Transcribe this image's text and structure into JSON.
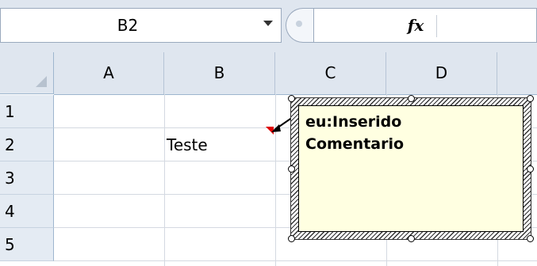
{
  "formula_bar": {
    "name_box": "B2",
    "fx_label": "fx",
    "formula_value": ""
  },
  "columns": [
    "A",
    "B",
    "C",
    "D"
  ],
  "rows": [
    "1",
    "2",
    "3",
    "4",
    "5"
  ],
  "cells": {
    "B2": "Teste"
  },
  "comment": {
    "text": "eu:Inserido\nComentario"
  },
  "colors": {
    "comment_background": "#ffffe1",
    "comment_indicator": "#e00000",
    "header_background": "#dfe6ef"
  },
  "icons": {
    "name_box_dropdown": "chevron-down-icon",
    "cancel": "cancel-icon",
    "function": "fx-icon",
    "select_all": "select-all-triangle-icon"
  }
}
